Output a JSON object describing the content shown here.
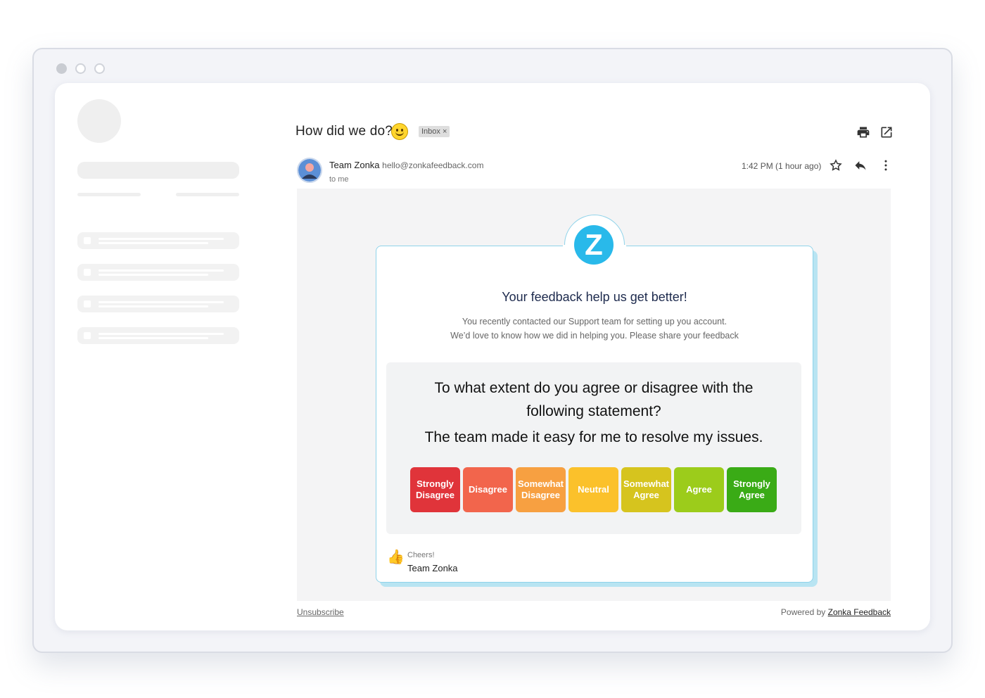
{
  "email": {
    "subject": "How did we do?",
    "label_badge": "Inbox ×",
    "sender_name": "Team Zonka",
    "sender_email": "hello@zonkafeedback.com",
    "recipient": "to me",
    "time": "1:42 PM (1 hour ago)",
    "icons": [
      "print-icon",
      "open-in-new-icon",
      "star-icon",
      "reply-icon",
      "more-vert-icon"
    ]
  },
  "survey": {
    "logo_letter": "Z",
    "title": "Your feedback help us get better!",
    "subtitle_line1": "You recently contacted our Support team for setting up you account.",
    "subtitle_line2": "We’d love to know how we did in helping you. Please share your feedback",
    "question": "To what extent do you agree or disagree with the following statement?",
    "statement": "The team made it easy for me to resolve my issues.",
    "options": [
      {
        "label": "Strongly\nDisagree",
        "color": "#e0343a"
      },
      {
        "label": "Disagree",
        "color": "#f2654c"
      },
      {
        "label": "Somewhat\nDisagree",
        "color": "#f7a041"
      },
      {
        "label": "Neutral",
        "color": "#fbc12b"
      },
      {
        "label": "Somewhat\nAgree",
        "color": "#d6c41e"
      },
      {
        "label": "Agree",
        "color": "#9ccc1b"
      },
      {
        "label": "Strongly\nAgree",
        "color": "#3aab16"
      }
    ],
    "closing": "Cheers!",
    "signature": "Team Zonka"
  },
  "footer": {
    "unsubscribe": "Unsubscribe",
    "powered_prefix": "Powered by ",
    "powered_link": "Zonka Feedback"
  }
}
